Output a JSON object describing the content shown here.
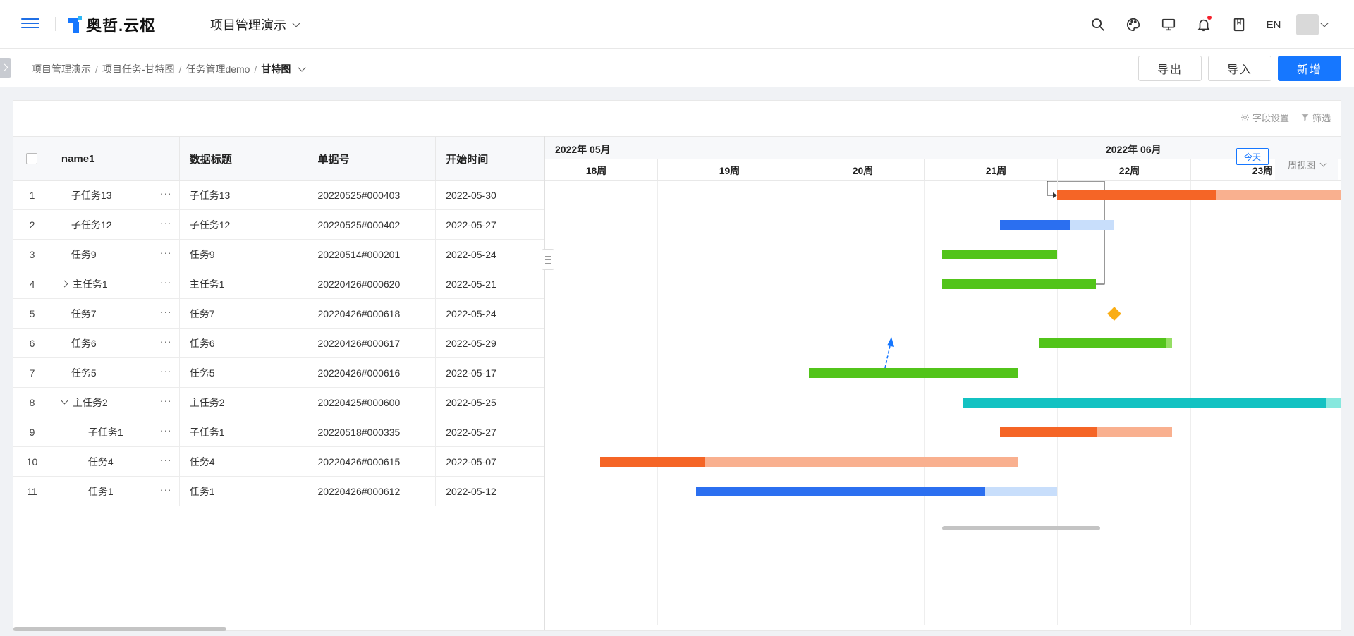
{
  "header": {
    "logo_text": "奥哲.云枢",
    "project_name": "项目管理演示",
    "lang": "EN"
  },
  "breadcrumb": {
    "items": [
      "项目管理演示",
      "项目任务-甘特图",
      "任务管理demo"
    ],
    "current": "甘特图",
    "separator": "/"
  },
  "actions": {
    "export_label": "导出",
    "import_label": "导入",
    "new_label": "新增"
  },
  "panel": {
    "field_settings_label": "字段设置",
    "filter_label": "筛选"
  },
  "table": {
    "columns": [
      "name1",
      "数据标题",
      "单据号",
      "开始时间"
    ],
    "rows": [
      {
        "index": "1",
        "name": "子任务13",
        "title": "子任务13",
        "code": "20220525#000403",
        "start": "2022-05-30",
        "level": 1,
        "expand": ""
      },
      {
        "index": "2",
        "name": "子任务12",
        "title": "子任务12",
        "code": "20220525#000402",
        "start": "2022-05-27",
        "level": 1,
        "expand": ""
      },
      {
        "index": "3",
        "name": "任务9",
        "title": "任务9",
        "code": "20220514#000201",
        "start": "2022-05-24",
        "level": 1,
        "expand": ""
      },
      {
        "index": "4",
        "name": "主任务1",
        "title": "主任务1",
        "code": "20220426#000620",
        "start": "2022-05-21",
        "level": 0,
        "expand": "collapsed"
      },
      {
        "index": "5",
        "name": "任务7",
        "title": "任务7",
        "code": "20220426#000618",
        "start": "2022-05-24",
        "level": 1,
        "expand": ""
      },
      {
        "index": "6",
        "name": "任务6",
        "title": "任务6",
        "code": "20220426#000617",
        "start": "2022-05-29",
        "level": 1,
        "expand": ""
      },
      {
        "index": "7",
        "name": "任务5",
        "title": "任务5",
        "code": "20220426#000616",
        "start": "2022-05-17",
        "level": 1,
        "expand": ""
      },
      {
        "index": "8",
        "name": "主任务2",
        "title": "主任务2",
        "code": "20220425#000600",
        "start": "2022-05-25",
        "level": 0,
        "expand": "expanded"
      },
      {
        "index": "9",
        "name": "子任务1",
        "title": "子任务1",
        "code": "20220518#000335",
        "start": "2022-05-27",
        "level": 2,
        "expand": ""
      },
      {
        "index": "10",
        "name": "任务4",
        "title": "任务4",
        "code": "20220426#000615",
        "start": "2022-05-07",
        "level": 2,
        "expand": ""
      },
      {
        "index": "11",
        "name": "任务1",
        "title": "任务1",
        "code": "20220426#000612",
        "start": "2022-05-12",
        "level": 2,
        "expand": ""
      }
    ],
    "more_glyph": "···"
  },
  "gantt": {
    "months": [
      "2022年 05月",
      "2022年 06月"
    ],
    "weeks": [
      "18周",
      "19周",
      "20周",
      "21周",
      "22周",
      "23周"
    ],
    "today_label": "今天",
    "view_label": "周视图",
    "colors": {
      "orange": "#f56526",
      "orange_light": "#f9b08f",
      "blue": "#2b6ff0",
      "blue_light": "#c8defb",
      "green": "#52c41a",
      "green_light": "#95de64",
      "cyan": "#13c2c2",
      "cyan_light": "#87e8de",
      "milestone": "#faad14"
    },
    "tasks": [
      {
        "row": 0,
        "start_week": 4.0,
        "end_week": 6.15,
        "progress": 0.56,
        "color": "orange"
      },
      {
        "row": 1,
        "start_week": 3.57,
        "end_week": 4.43,
        "progress": 0.61,
        "color": "blue"
      },
      {
        "row": 2,
        "start_week": 3.14,
        "end_week": 4.0,
        "progress": 1.0,
        "color": "green"
      },
      {
        "row": 3,
        "start_week": 3.14,
        "end_week": 4.29,
        "progress": 1.0,
        "color": "green"
      },
      {
        "row": 4,
        "milestone_week": 4.43
      },
      {
        "row": 5,
        "start_week": 3.86,
        "end_week": 4.86,
        "progress": 0.96,
        "color": "green"
      },
      {
        "row": 6,
        "start_week": 2.14,
        "end_week": 3.71,
        "progress": 1.0,
        "color": "green"
      },
      {
        "row": 7,
        "start_week": 3.29,
        "end_week": 6.15,
        "progress": 0.96,
        "color": "cyan"
      },
      {
        "row": 8,
        "start_week": 3.57,
        "end_week": 4.86,
        "progress": 0.56,
        "color": "orange"
      },
      {
        "row": 9,
        "start_week": 0.57,
        "end_week": 3.71,
        "progress": 0.25,
        "color": "orange"
      },
      {
        "row": 10,
        "start_week": 1.29,
        "end_week": 4.0,
        "progress": 0.8,
        "color": "blue"
      }
    ]
  }
}
